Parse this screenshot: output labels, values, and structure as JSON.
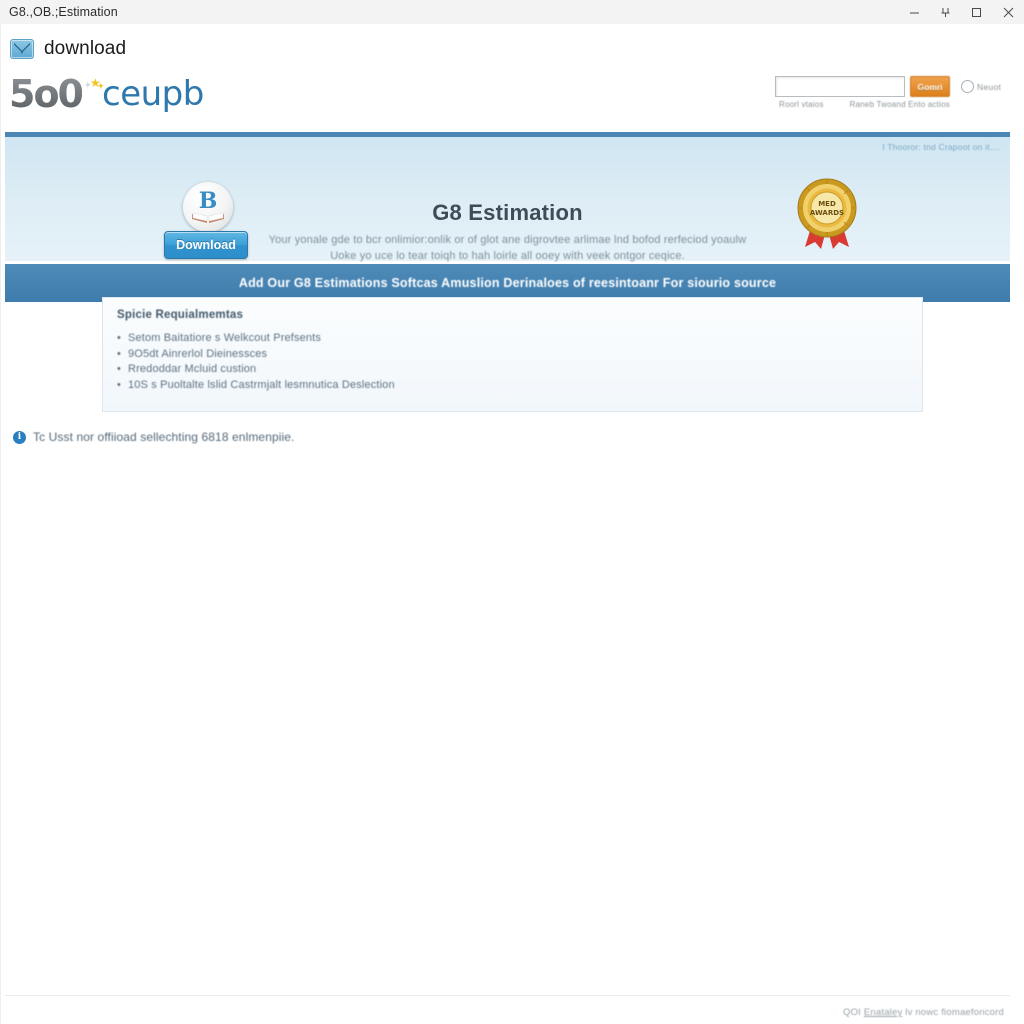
{
  "window": {
    "title": "G8.,OB.;Estimation",
    "controls": [
      {
        "name": "minimize",
        "glyph": "minimize-icon"
      },
      {
        "name": "restore-alt",
        "glyph": "pin-icon"
      },
      {
        "name": "maximize",
        "glyph": "maximize-icon"
      },
      {
        "name": "close",
        "glyph": "close-icon"
      }
    ]
  },
  "download_row": {
    "icon": "envelope-download-icon",
    "label": "download"
  },
  "site_header": {
    "logo": {
      "mark_left": "5o",
      "mark_right": "0",
      "word": "ceupb",
      "stars": [
        "✦",
        "★",
        "✦"
      ]
    },
    "search": {
      "value": "",
      "placeholder": "",
      "button_label": "Gomri"
    },
    "account": {
      "icon": "account-circle-icon",
      "label": "Neuot"
    },
    "sublinks": [
      "Roorl vtaios",
      "Raneb Twoand Ento actios"
    ]
  },
  "hero": {
    "corner_link": "I Thooror: tnd Crapoot on it....",
    "book_badge": {
      "icon": "book-badge-icon",
      "letter": "B"
    },
    "download_button": "Download",
    "title": "G8 Estimation",
    "subtitle_line1": "Your yonale gde to bcr onlimior:onlik or of glot ane digrovtee arlimae lnd bofod rerfeciod yoaulw",
    "subtitle_line2": "Uoke yo uce lo tear toiqh to hah loirle all ooey with veek ontgor ceqice.",
    "award": {
      "icon": "award-seal-icon",
      "line1": "MED",
      "line2": "AWARDS"
    }
  },
  "strip": {
    "text": "Add Our G8 Estimations Softcas Amuslion Derinaloes of reesintoanr For siourio source"
  },
  "card": {
    "title": "Spicie Requialmemtas",
    "items": [
      "Setom Baitatiore s Welkcout Prefsents",
      "9O5dt Ainrerlol Dieinessces",
      "Rredoddar Mcluid custion",
      "10S s Puoltalte lslid Castrmjalt lesmnutica Deslection"
    ]
  },
  "note": {
    "icon": "info-icon",
    "icon_glyph": "i",
    "text": "Tc Usst nor offiioad sellechting 6818 enlmenpiie."
  },
  "footer": {
    "text_before": "QOI ",
    "link_text": "Enataley",
    "text_after": " lv  nowc fiomaefoncord"
  },
  "colors": {
    "accent_blue": "#3f7cab",
    "hero_top": "#cfe6f2",
    "button_blue": "#2f93cf",
    "button_orange": "#dd7f1d",
    "info_blue": "#2a7fc1"
  }
}
